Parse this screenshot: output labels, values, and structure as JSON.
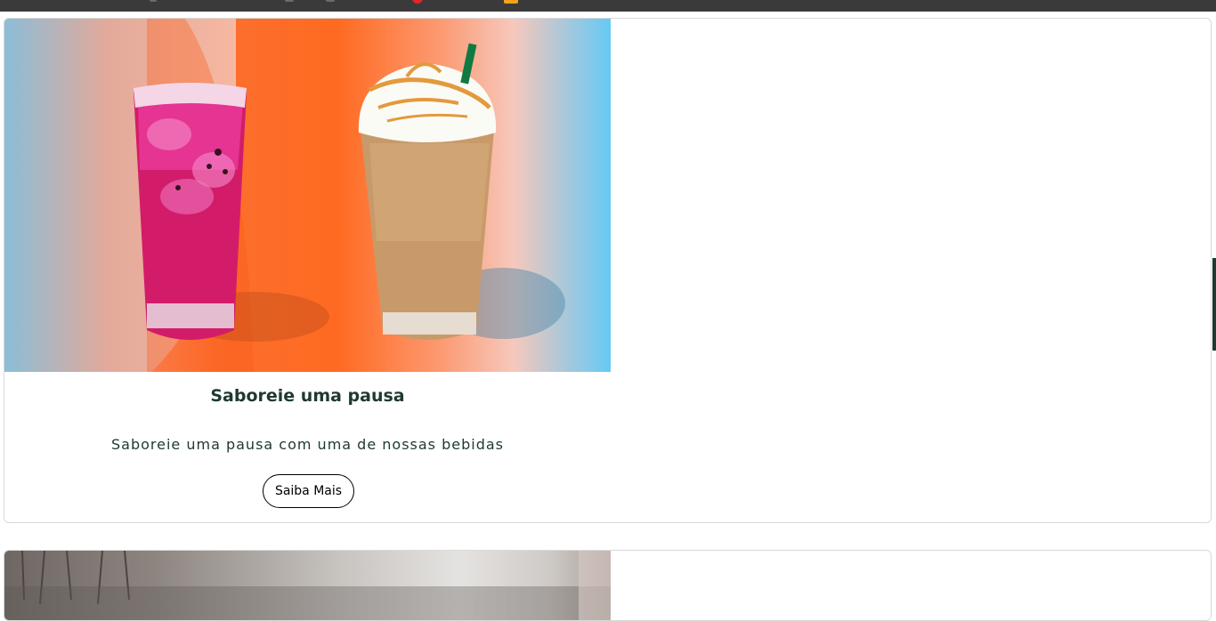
{
  "promo_card": {
    "title": "Saboreie uma pausa",
    "description": "Saboreie uma pausa com uma de nossas bebidas",
    "button_label": "Saiba Mais"
  },
  "colors": {
    "topbar": "#3a3a3a",
    "text_green": "#1e3932",
    "hero_orange": "#ff6a21",
    "hero_blue": "#5ec8f7"
  },
  "icons": {
    "topbar_red": "notification-dot-icon",
    "topbar_gift": "gift-icon"
  }
}
